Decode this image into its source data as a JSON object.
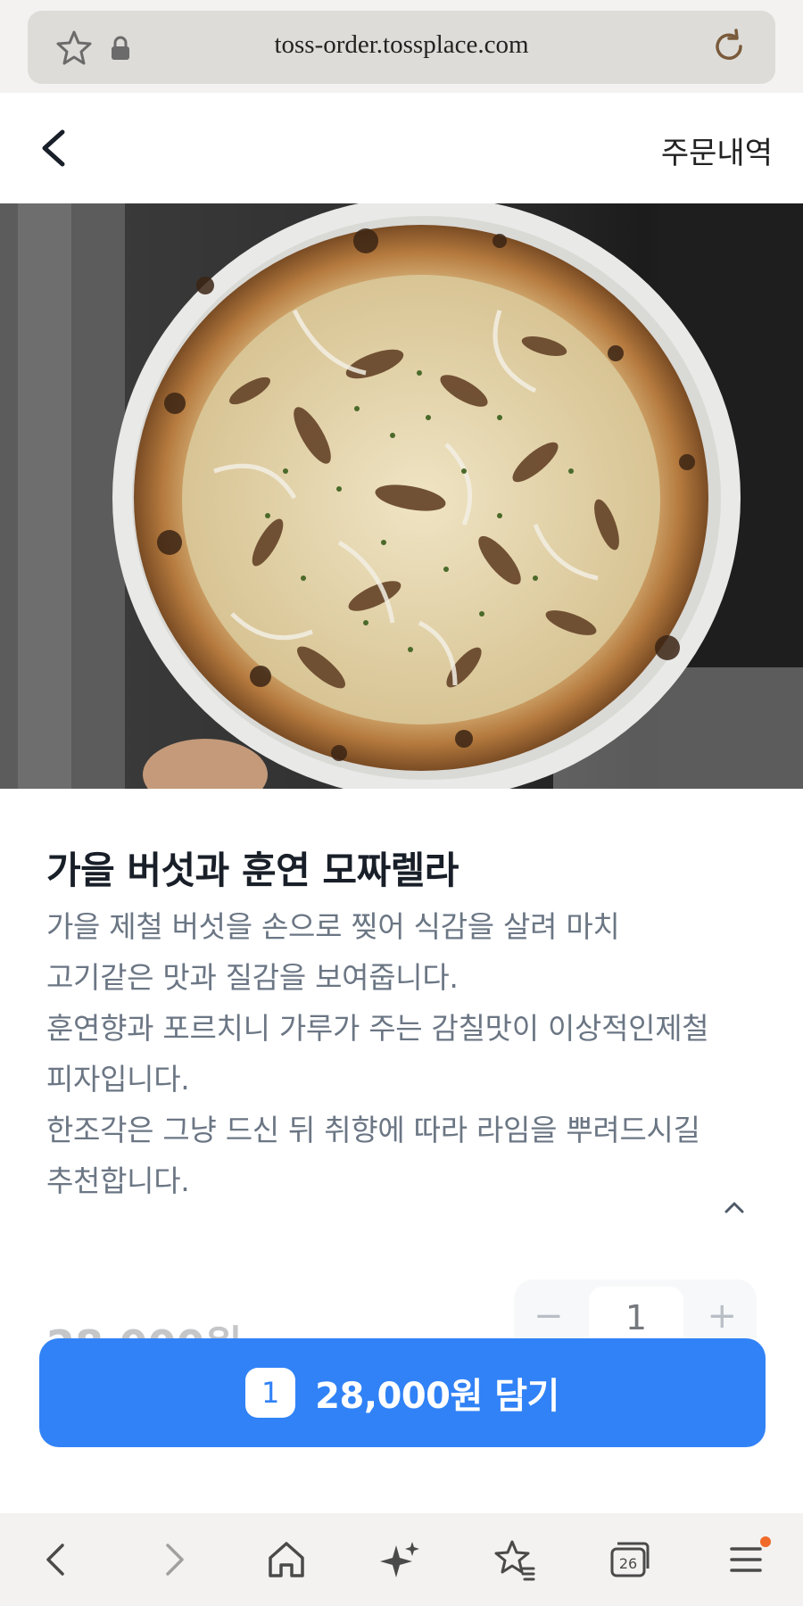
{
  "browser": {
    "url": "toss-order.tossplace.com",
    "icons": {
      "bookmark": "star-icon",
      "lock": "lock-icon",
      "reload": "reload-icon"
    }
  },
  "header": {
    "back_icon": "chevron-left-icon",
    "orders_label": "주문내역"
  },
  "menu": {
    "name": "가을 버섯과 훈연 모짜렐라",
    "description_lines": [
      "가을 제철 버섯을 손으로 찢어 식감을 살려 마치",
      "고기같은 맛과 질감을 보여줍니다.",
      "훈연향과 포르치니 가루가 주는 감칠맛이 이상적인제철",
      "피자입니다.",
      "한조각은 그냥 드신 뒤 취향에 따라 라임을 뿌려드시길",
      "추천합니다."
    ],
    "price": "28,000원",
    "quantity": "1"
  },
  "cta": {
    "count": "1",
    "label": "28,000원 담기"
  },
  "bottom_nav": {
    "tabs_count": "26",
    "icons": [
      "back-icon",
      "forward-icon",
      "home-icon",
      "sparkle-icon",
      "bookmarks-icon",
      "tabs-icon",
      "menu-icon"
    ]
  },
  "colors": {
    "accent": "#3182f6",
    "notification_dot": "#f06a2a"
  }
}
